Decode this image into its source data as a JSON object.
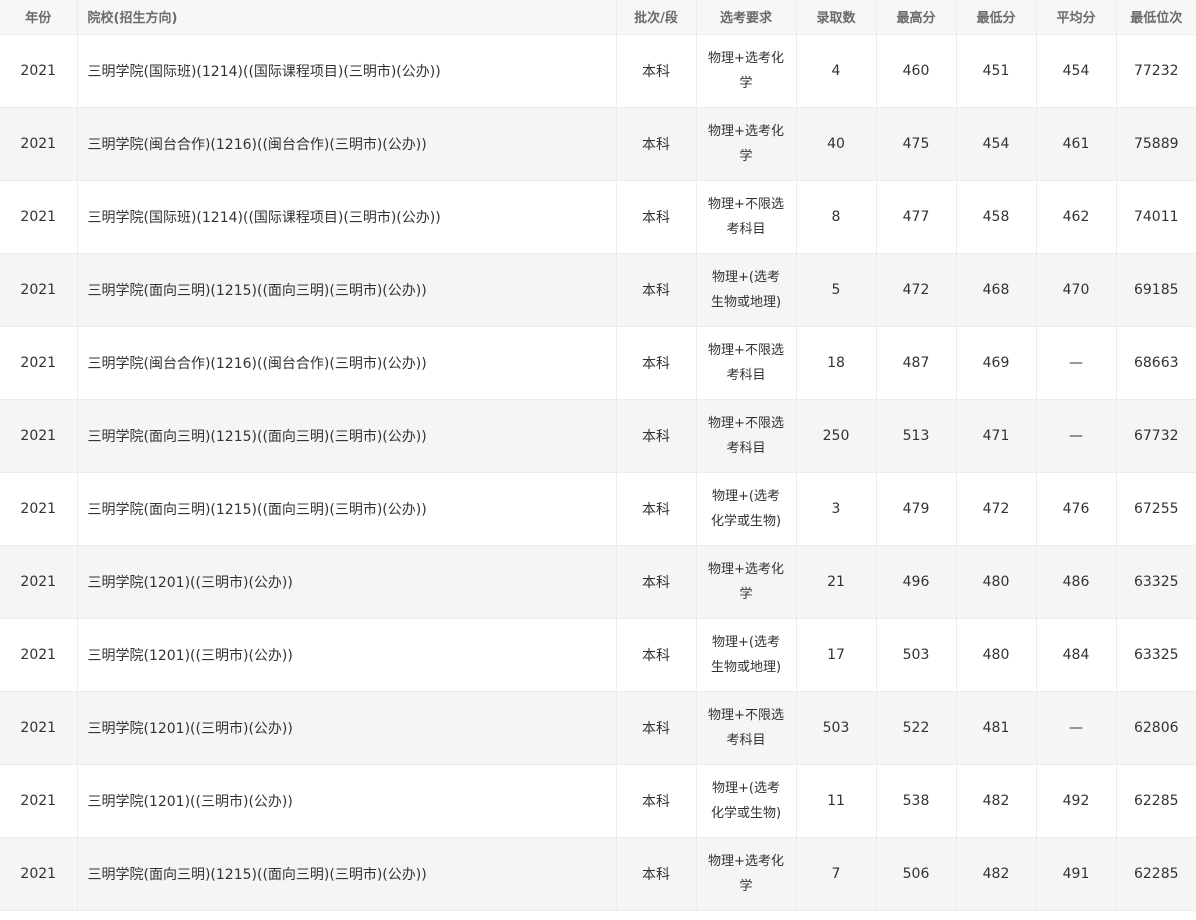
{
  "table": {
    "headers": {
      "year": "年份",
      "school": "院校(招生方向)",
      "batch": "批次/段",
      "requirement": "选考要求",
      "admitted": "录取数",
      "max_score": "最高分",
      "min_score": "最低分",
      "avg_score": "平均分",
      "min_rank": "最低位次"
    },
    "rows": [
      {
        "year": "2021",
        "school": "三明学院(国际班)(1214)((国际课程项目)(三明市)(公办))",
        "batch": "本科",
        "requirement": "物理+选考化学",
        "admitted": "4",
        "max_score": "460",
        "min_score": "451",
        "avg_score": "454",
        "min_rank": "77232"
      },
      {
        "year": "2021",
        "school": "三明学院(闽台合作)(1216)((闽台合作)(三明市)(公办))",
        "batch": "本科",
        "requirement": "物理+选考化学",
        "admitted": "40",
        "max_score": "475",
        "min_score": "454",
        "avg_score": "461",
        "min_rank": "75889"
      },
      {
        "year": "2021",
        "school": "三明学院(国际班)(1214)((国际课程项目)(三明市)(公办))",
        "batch": "本科",
        "requirement": "物理+不限选考科目",
        "admitted": "8",
        "max_score": "477",
        "min_score": "458",
        "avg_score": "462",
        "min_rank": "74011"
      },
      {
        "year": "2021",
        "school": "三明学院(面向三明)(1215)((面向三明)(三明市)(公办))",
        "batch": "本科",
        "requirement": "物理+(选考生物或地理)",
        "admitted": "5",
        "max_score": "472",
        "min_score": "468",
        "avg_score": "470",
        "min_rank": "69185"
      },
      {
        "year": "2021",
        "school": "三明学院(闽台合作)(1216)((闽台合作)(三明市)(公办))",
        "batch": "本科",
        "requirement": "物理+不限选考科目",
        "admitted": "18",
        "max_score": "487",
        "min_score": "469",
        "avg_score": "—",
        "min_rank": "68663"
      },
      {
        "year": "2021",
        "school": "三明学院(面向三明)(1215)((面向三明)(三明市)(公办))",
        "batch": "本科",
        "requirement": "物理+不限选考科目",
        "admitted": "250",
        "max_score": "513",
        "min_score": "471",
        "avg_score": "—",
        "min_rank": "67732"
      },
      {
        "year": "2021",
        "school": "三明学院(面向三明)(1215)((面向三明)(三明市)(公办))",
        "batch": "本科",
        "requirement": "物理+(选考化学或生物)",
        "admitted": "3",
        "max_score": "479",
        "min_score": "472",
        "avg_score": "476",
        "min_rank": "67255"
      },
      {
        "year": "2021",
        "school": "三明学院(1201)((三明市)(公办))",
        "batch": "本科",
        "requirement": "物理+选考化学",
        "admitted": "21",
        "max_score": "496",
        "min_score": "480",
        "avg_score": "486",
        "min_rank": "63325"
      },
      {
        "year": "2021",
        "school": "三明学院(1201)((三明市)(公办))",
        "batch": "本科",
        "requirement": "物理+(选考生物或地理)",
        "admitted": "17",
        "max_score": "503",
        "min_score": "480",
        "avg_score": "484",
        "min_rank": "63325"
      },
      {
        "year": "2021",
        "school": "三明学院(1201)((三明市)(公办))",
        "batch": "本科",
        "requirement": "物理+不限选考科目",
        "admitted": "503",
        "max_score": "522",
        "min_score": "481",
        "avg_score": "—",
        "min_rank": "62806"
      },
      {
        "year": "2021",
        "school": "三明学院(1201)((三明市)(公办))",
        "batch": "本科",
        "requirement": "物理+(选考化学或生物)",
        "admitted": "11",
        "max_score": "538",
        "min_score": "482",
        "avg_score": "492",
        "min_rank": "62285"
      },
      {
        "year": "2021",
        "school": "三明学院(面向三明)(1215)((面向三明)(三明市)(公办))",
        "batch": "本科",
        "requirement": "物理+选考化学",
        "admitted": "7",
        "max_score": "506",
        "min_score": "482",
        "avg_score": "491",
        "min_rank": "62285"
      }
    ]
  }
}
